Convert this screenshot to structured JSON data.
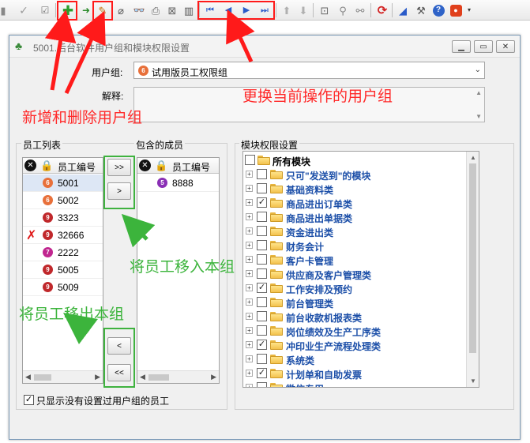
{
  "toolbar": {
    "icons": [
      "toggle-icon",
      "confirm-icon",
      "check-list-icon",
      "add-user-icon",
      "indent-icon",
      "edit-icon",
      "erase-icon",
      "find-icon",
      "print-icon",
      "close-doc-icon",
      "books-icon",
      "first-icon",
      "prev-icon",
      "next-icon",
      "last-icon",
      "up-icon",
      "down-icon",
      "preview-icon",
      "lock-search-icon",
      "link-icon",
      "refresh-icon",
      "speaker-icon",
      "tools-icon",
      "help-icon",
      "exit-icon",
      "more-icon"
    ]
  },
  "dialog": {
    "title": "5001.后台软件用户组和模块权限设置",
    "user_group_label": "用户组:",
    "user_group_value": "试用版员工权限组",
    "user_group_badge": "6",
    "explain_label": "解释:",
    "employee_list_title": "员工列表",
    "members_title": "包含的成员",
    "column_employee_id": "员工编号",
    "employees": [
      {
        "id": "5001",
        "badge": "6",
        "badge_color": "#e8703a",
        "removed": false,
        "selected": true
      },
      {
        "id": "5002",
        "badge": "6",
        "badge_color": "#e8703a",
        "removed": false,
        "selected": false
      },
      {
        "id": "3323",
        "badge": "9",
        "badge_color": "#c0282b",
        "removed": false,
        "selected": false
      },
      {
        "id": "32666",
        "badge": "9",
        "badge_color": "#c0282b",
        "removed": true,
        "selected": false
      },
      {
        "id": "2222",
        "badge": "7",
        "badge_color": "#c0268f",
        "removed": false,
        "selected": false
      },
      {
        "id": "5005",
        "badge": "9",
        "badge_color": "#c0282b",
        "removed": false,
        "selected": false
      },
      {
        "id": "5009",
        "badge": "9",
        "badge_color": "#c0282b",
        "removed": false,
        "selected": false
      }
    ],
    "members": [
      {
        "id": "8888",
        "badge": "5",
        "badge_color": "#8a2fb5"
      }
    ],
    "btn_add_all": ">>",
    "btn_add": ">",
    "btn_remove": "<",
    "btn_remove_all": "<<",
    "only_unassigned_label": "只显示没有设置过用户组的员工",
    "only_unassigned_checked": true,
    "module_title": "模块权限设置",
    "modules": [
      {
        "label": "所有模块",
        "checked": false,
        "root": true
      },
      {
        "label": "只可\"发送到\"的模块",
        "checked": false
      },
      {
        "label": "基础资料类",
        "checked": false
      },
      {
        "label": "商品进出订单类",
        "checked": true
      },
      {
        "label": "商品进出单据类",
        "checked": false
      },
      {
        "label": "资金进出类",
        "checked": false
      },
      {
        "label": "财务会计",
        "checked": false
      },
      {
        "label": "客户卡管理",
        "checked": false
      },
      {
        "label": "供应商及客户管理类",
        "checked": false
      },
      {
        "label": "工作安排及预约",
        "checked": true
      },
      {
        "label": "前台管理类",
        "checked": false
      },
      {
        "label": "前台收款机报表类",
        "checked": false
      },
      {
        "label": "岗位绩效及生产工序类",
        "checked": false
      },
      {
        "label": "冲印业生产流程处理类",
        "checked": true
      },
      {
        "label": "系统类",
        "checked": false
      },
      {
        "label": "计划单和自助发票",
        "checked": true
      },
      {
        "label": "微信专用",
        "checked": false
      }
    ]
  },
  "annotations": {
    "add_delete": "新增和删除用户组",
    "change_group": "更换当前操作的用户组",
    "move_in": "将员工移入本组",
    "move_out": "将员工移出本组"
  },
  "colors": {
    "annotation_red": "#ff2a2a",
    "annotation_green": "#3cb43c",
    "tree_label": "#1c4fa8"
  }
}
